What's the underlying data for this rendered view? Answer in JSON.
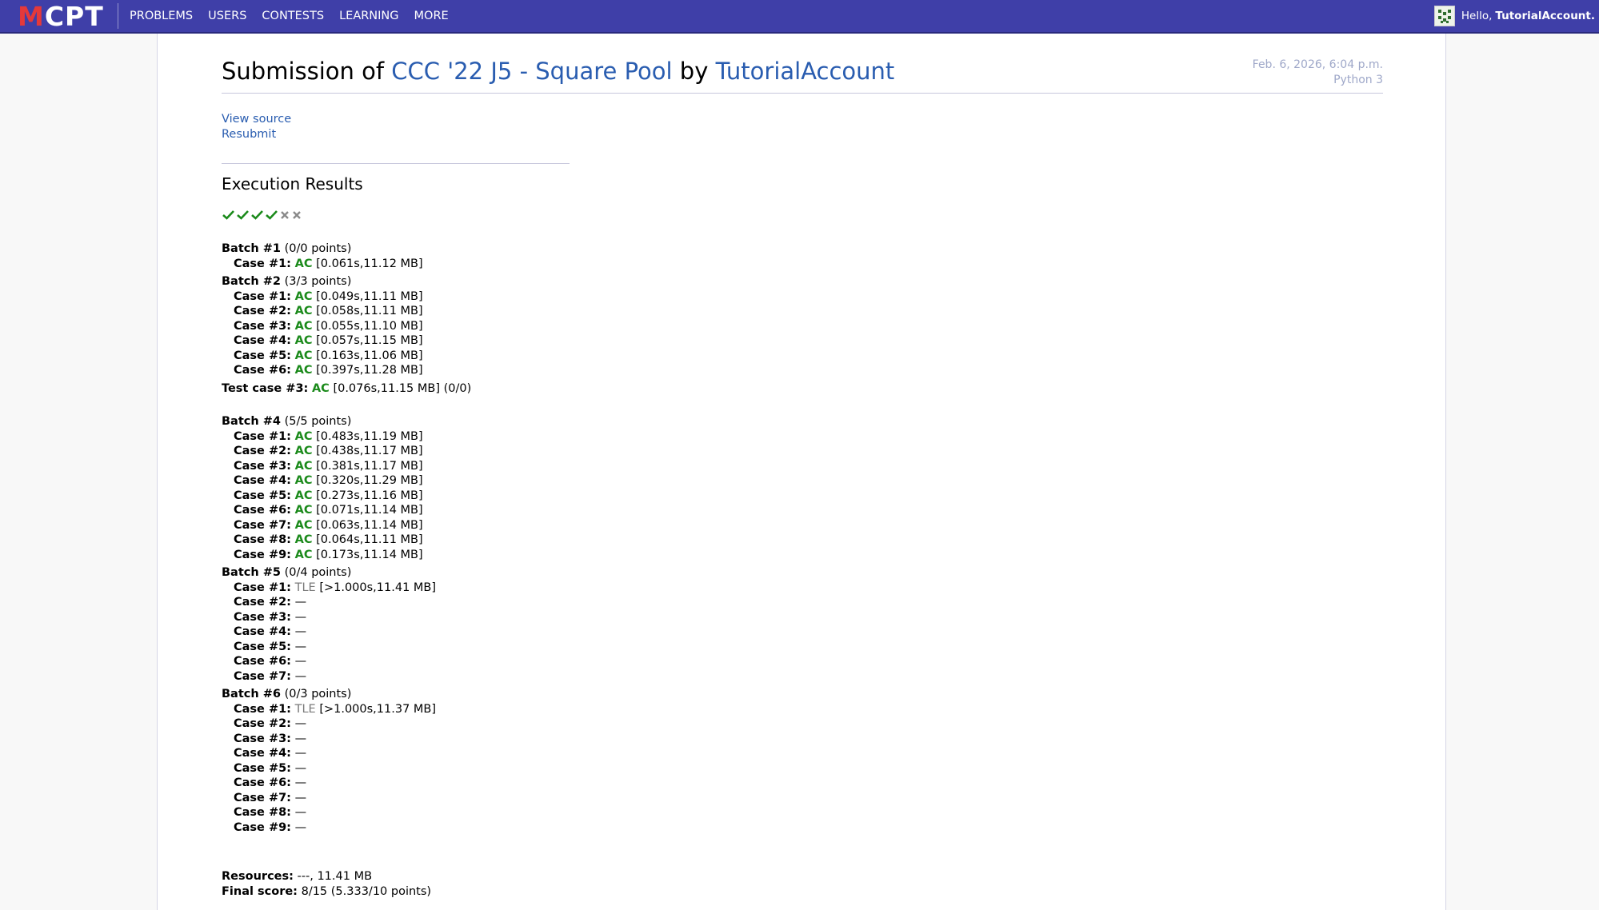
{
  "nav": {
    "logo_first": "M",
    "logo_rest": "CPT",
    "links": [
      "PROBLEMS",
      "USERS",
      "CONTESTS",
      "LEARNING",
      "MORE"
    ],
    "greeting": "Hello,",
    "username": "TutorialAccount."
  },
  "submission": {
    "title_prefix": "Submission of",
    "problem_name": "CCC '22 J5 - Square Pool",
    "by": "by",
    "author": "TutorialAccount",
    "date": "Feb. 6, 2026, 6:04 p.m.",
    "language": "Python 3"
  },
  "actions": {
    "view_source": "View source",
    "resubmit": "Resubmit"
  },
  "results": {
    "heading": "Execution Results",
    "summary_icons": [
      "check-icon",
      "check-icon",
      "check-icon",
      "check-icon",
      "x-icon",
      "x-icon"
    ],
    "batch1": {
      "label": "Batch #1",
      "points": "(0/0 points)",
      "cases": [
        {
          "label": "Case #1:",
          "status": "AC",
          "detail": "[0.061s,11.12 MB]"
        }
      ]
    },
    "batch2": {
      "label": "Batch #2",
      "points": "(3/3 points)",
      "cases": [
        {
          "label": "Case #1:",
          "status": "AC",
          "detail": "[0.049s,11.11 MB]"
        },
        {
          "label": "Case #2:",
          "status": "AC",
          "detail": "[0.058s,11.11 MB]"
        },
        {
          "label": "Case #3:",
          "status": "AC",
          "detail": "[0.055s,11.10 MB]"
        },
        {
          "label": "Case #4:",
          "status": "AC",
          "detail": "[0.057s,11.15 MB]"
        },
        {
          "label": "Case #5:",
          "status": "AC",
          "detail": "[0.163s,11.06 MB]"
        },
        {
          "label": "Case #6:",
          "status": "AC",
          "detail": "[0.397s,11.28 MB]"
        }
      ]
    },
    "testcase3": {
      "label": "Test case #3:",
      "status": "AC",
      "detail": "[0.076s,11.15 MB]",
      "points": "(0/0)"
    },
    "batch4": {
      "label": "Batch #4",
      "points": "(5/5 points)",
      "cases": [
        {
          "label": "Case #1:",
          "status": "AC",
          "detail": "[0.483s,11.19 MB]"
        },
        {
          "label": "Case #2:",
          "status": "AC",
          "detail": "[0.438s,11.17 MB]"
        },
        {
          "label": "Case #3:",
          "status": "AC",
          "detail": "[0.381s,11.17 MB]"
        },
        {
          "label": "Case #4:",
          "status": "AC",
          "detail": "[0.320s,11.29 MB]"
        },
        {
          "label": "Case #5:",
          "status": "AC",
          "detail": "[0.273s,11.16 MB]"
        },
        {
          "label": "Case #6:",
          "status": "AC",
          "detail": "[0.071s,11.14 MB]"
        },
        {
          "label": "Case #7:",
          "status": "AC",
          "detail": "[0.063s,11.14 MB]"
        },
        {
          "label": "Case #8:",
          "status": "AC",
          "detail": "[0.064s,11.11 MB]"
        },
        {
          "label": "Case #9:",
          "status": "AC",
          "detail": "[0.173s,11.14 MB]"
        }
      ]
    },
    "batch5": {
      "label": "Batch #5",
      "points": "(0/4 points)",
      "cases": [
        {
          "label": "Case #1:",
          "status": "TLE",
          "detail": "[>1.000s,11.41 MB]"
        },
        {
          "label": "Case #2:",
          "status": "",
          "detail": "—"
        },
        {
          "label": "Case #3:",
          "status": "",
          "detail": "—"
        },
        {
          "label": "Case #4:",
          "status": "",
          "detail": "—"
        },
        {
          "label": "Case #5:",
          "status": "",
          "detail": "—"
        },
        {
          "label": "Case #6:",
          "status": "",
          "detail": "—"
        },
        {
          "label": "Case #7:",
          "status": "",
          "detail": "—"
        }
      ]
    },
    "batch6": {
      "label": "Batch #6",
      "points": "(0/3 points)",
      "cases": [
        {
          "label": "Case #1:",
          "status": "TLE",
          "detail": "[>1.000s,11.37 MB]"
        },
        {
          "label": "Case #2:",
          "status": "",
          "detail": "—"
        },
        {
          "label": "Case #3:",
          "status": "",
          "detail": "—"
        },
        {
          "label": "Case #4:",
          "status": "",
          "detail": "—"
        },
        {
          "label": "Case #5:",
          "status": "",
          "detail": "—"
        },
        {
          "label": "Case #6:",
          "status": "",
          "detail": "—"
        },
        {
          "label": "Case #7:",
          "status": "",
          "detail": "—"
        },
        {
          "label": "Case #8:",
          "status": "",
          "detail": "—"
        },
        {
          "label": "Case #9:",
          "status": "",
          "detail": "—"
        }
      ]
    }
  },
  "footer": {
    "resources_label": "Resources:",
    "resources_value": "---, 11.41 MB",
    "final_label": "Final score:",
    "final_value": "8/15 (5.333/10 points)"
  },
  "colors": {
    "navbar": "#3f3fa8",
    "link": "#2a5db0",
    "ac": "#1b8a1b",
    "tle": "#7a7a7a",
    "logo_accent": "#e5393a"
  }
}
